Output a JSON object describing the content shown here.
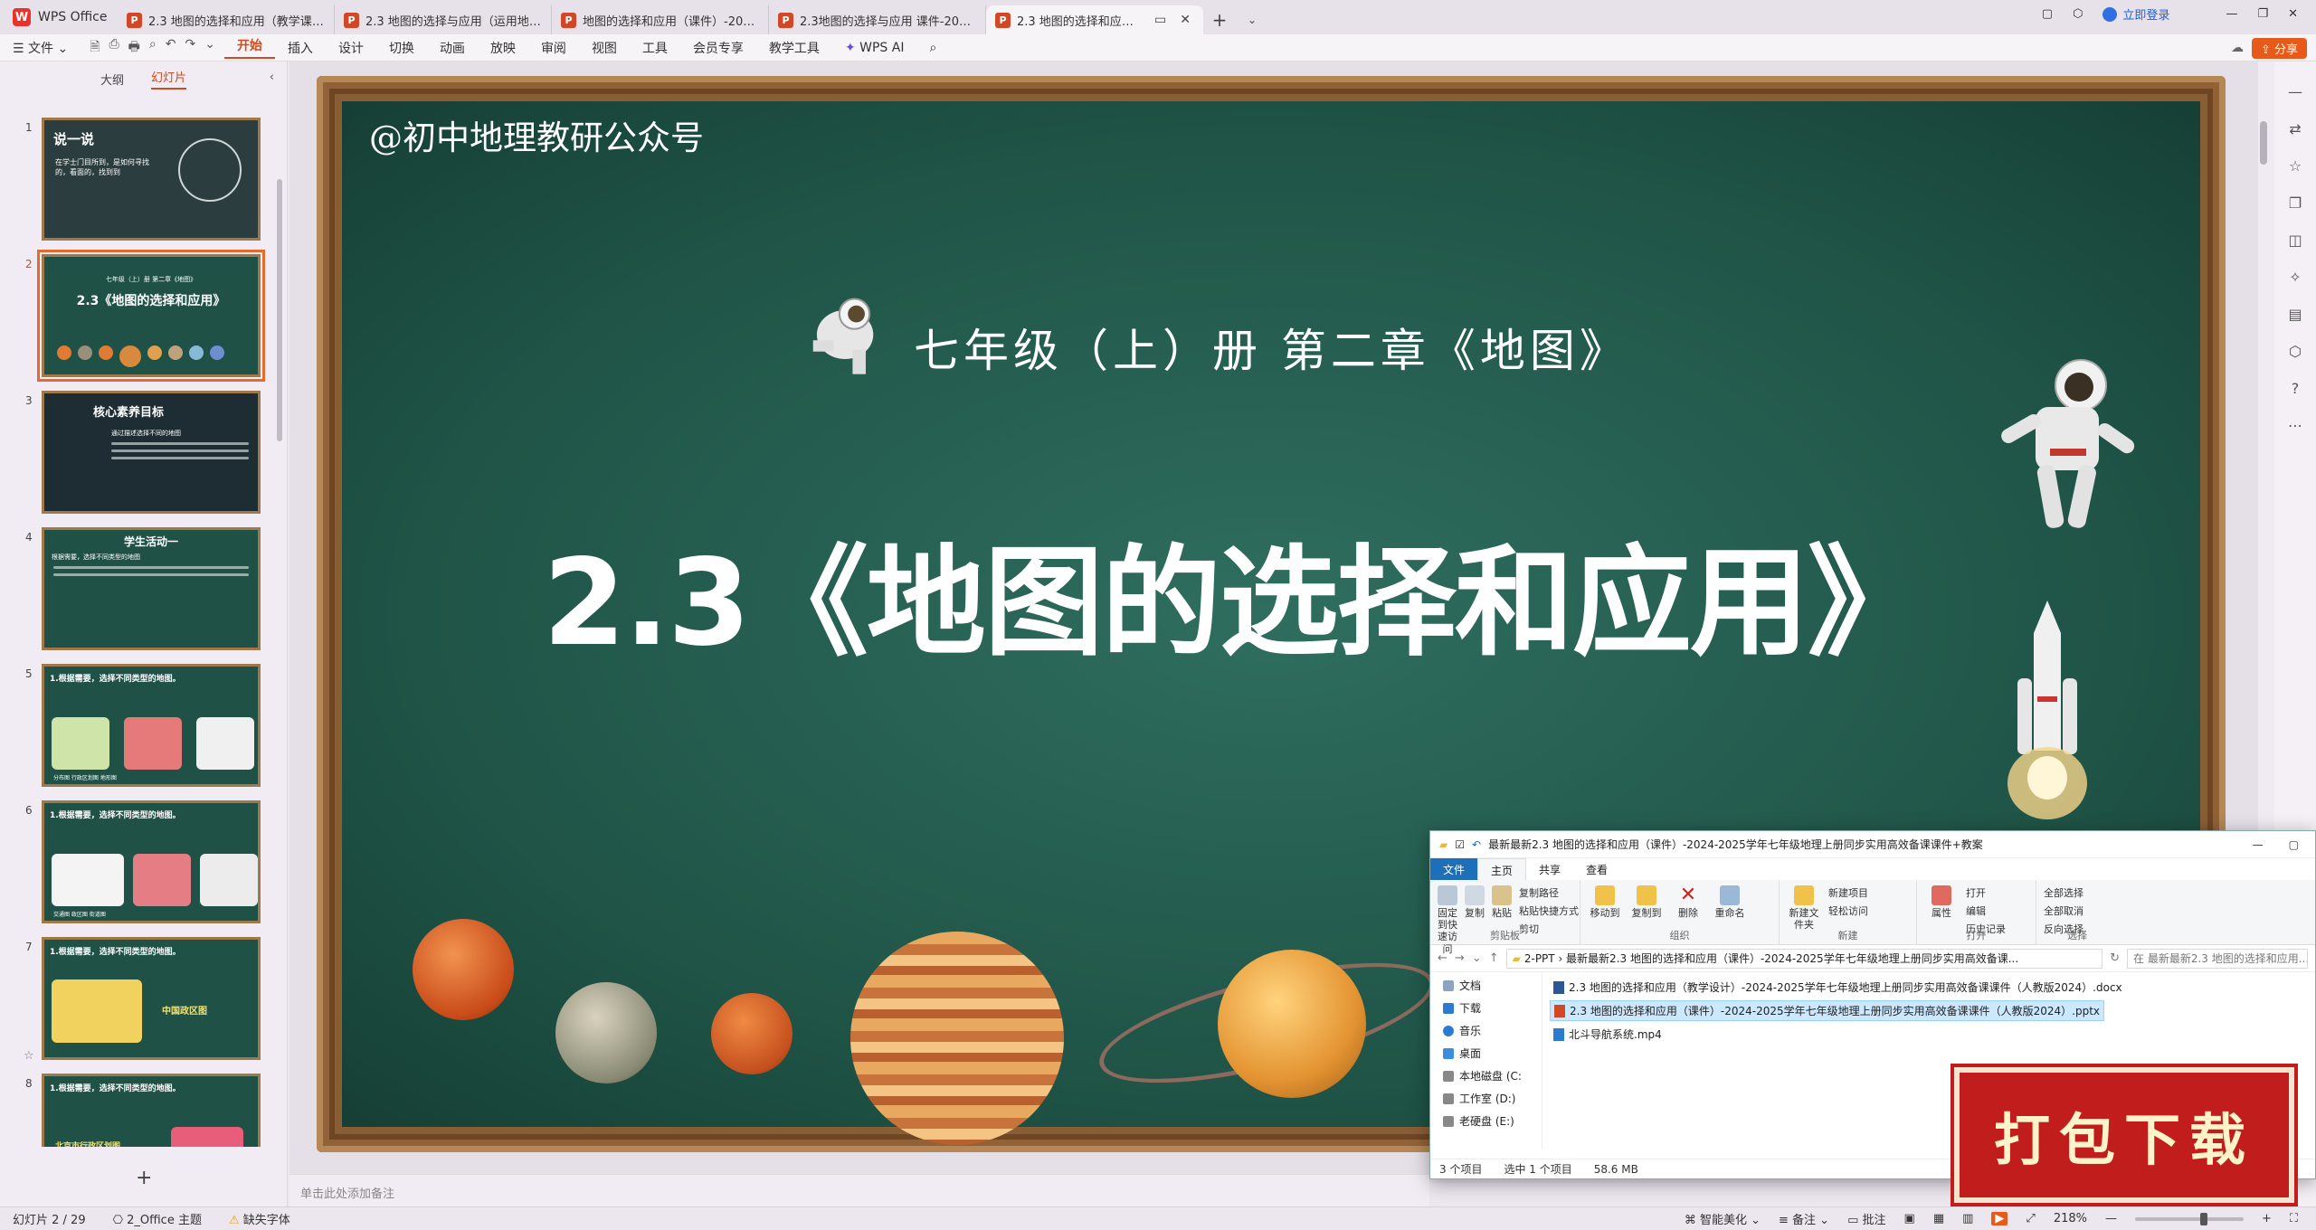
{
  "tabs": {
    "app": "WPS Office",
    "docs": [
      {
        "label": "2.3 地图的选择和应用（教学课件）-"
      },
      {
        "label": "2.3 地图的选择与应用（运用地图——"
      },
      {
        "label": "地图的选择和应用（课件）-2024-20"
      },
      {
        "label": "2.3地图的选择与应用 课件-2024-202"
      },
      {
        "label": "2.3 地图的选择和应用（课件）"
      }
    ],
    "login": "立即登录"
  },
  "ribbon": {
    "file": "文件",
    "items": [
      "开始",
      "插入",
      "设计",
      "切换",
      "动画",
      "放映",
      "审阅",
      "视图",
      "工具",
      "会员专享",
      "教学工具"
    ],
    "ai": "WPS AI",
    "share": "分享"
  },
  "leftpanel": {
    "tab_outline": "大纲",
    "tab_slides": "幻灯片",
    "thumbs": [
      {
        "num": "1",
        "title": "说一说",
        "text": "在学士门目所到，是如何寻找的，看面的，找到到"
      },
      {
        "num": "2",
        "title": "2.3《地图的选择和应用》",
        "text": "七年级（上）册 第二章《地图》"
      },
      {
        "num": "3",
        "title": "核心素养目标",
        "text": "通过描述选择不同的地图"
      },
      {
        "num": "4",
        "title": "学生活动一",
        "text": "根据需要，选择不同类型的地图"
      },
      {
        "num": "5",
        "title": "1.根据需要，选择不同类型的地图。",
        "text": "分布图 行政区划图 地形图"
      },
      {
        "num": "6",
        "title": "1.根据需要，选择不同类型的地图。",
        "text": "交通图 政区图 街道图"
      },
      {
        "num": "7",
        "title": "1.根据需要，选择不同类型的地图。",
        "text": "中国政区图"
      },
      {
        "num": "8",
        "title": "1.根据需要，选择不同类型的地图。",
        "text": "北京市行政区划图"
      }
    ]
  },
  "slide": {
    "handle": "@初中地理教研公众号",
    "subtitle": "七年级（上）册  第二章《地图》",
    "title": "2.3《地图的选择和应用》"
  },
  "notes_placeholder": "单击此处添加备注",
  "status": {
    "slide_index": "幻灯片 2 / 29",
    "theme": "2_Office 主题",
    "font_warning": "缺失字体",
    "smart": "智能美化",
    "notes": "备注",
    "comments": "批注",
    "zoom": "218%"
  },
  "explorer": {
    "title": "最新最新2.3 地图的选择和应用（课件）-2024-2025学年七年级地理上册同步实用高效备课课件+教案",
    "tabs": [
      "文件",
      "主页",
      "共享",
      "查看"
    ],
    "groups": {
      "clipboard": {
        "label": "剪贴板",
        "pin": "固定到快速访问",
        "copy": "复制",
        "paste": "粘贴",
        "copy_path": "复制路径",
        "paste_shortcut": "粘贴快捷方式",
        "cut": "剪切"
      },
      "organize": {
        "label": "组织",
        "move": "移动到",
        "copyto": "复制到",
        "delete": "删除",
        "rename": "重命名"
      },
      "new": {
        "label": "新建",
        "folder": "新建文件夹",
        "item": "新建项目",
        "easy": "轻松访问"
      },
      "open": {
        "label": "打开",
        "props": "属性",
        "open": "打开",
        "edit": "编辑",
        "history": "历史记录"
      },
      "select": {
        "label": "选择",
        "all": "全部选择",
        "none": "全部取消",
        "invert": "反向选择"
      }
    },
    "address": "2-PPT  ›  最新最新2.3 地图的选择和应用（课件）-2024-2025学年七年级地理上册同步实用高效备课...",
    "search": "在 最新最新2.3 地图的选择和应用...",
    "nav": [
      "文档",
      "下载",
      "音乐",
      "桌面",
      "本地磁盘 (C:",
      "工作室 (D:)",
      "老硬盘 (E:)"
    ],
    "files": [
      {
        "name": "2.3 地图的选择和应用（教学设计）-2024-2025学年七年级地理上册同步实用高效备课课件（人教版2024）.docx",
        "type": "docx"
      },
      {
        "name": "2.3 地图的选择和应用（课件）-2024-2025学年七年级地理上册同步实用高效备课课件（人教版2024）.pptx",
        "type": "pptx"
      },
      {
        "name": "北斗导航系统.mp4",
        "type": "mp4"
      }
    ],
    "status_count": "3 个项目",
    "status_sel": "选中 1 个项目",
    "status_size": "58.6 MB"
  },
  "badge": "打包下载",
  "colors": {
    "accent": "#d04a1e",
    "board": "#1f5447",
    "frame": "#8a5e35",
    "badge": "#c21d1d"
  }
}
